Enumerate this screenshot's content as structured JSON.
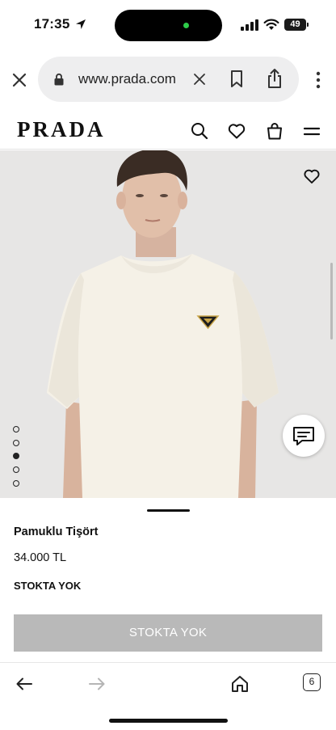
{
  "status_bar": {
    "time": "17:35",
    "battery": "49"
  },
  "browser": {
    "url": "www.prada.com"
  },
  "site": {
    "logo": "PRADA"
  },
  "gallery": {
    "image_count": 5,
    "active_index": 2
  },
  "product": {
    "name": "Pamuklu Tişört",
    "price": "34.000 TL",
    "stock_status": "STOKTA YOK",
    "button_label": "STOKTA YOK"
  },
  "toolbar": {
    "tab_count": "6"
  },
  "colors": {
    "button_disabled": "#b9b9b9",
    "image_background": "#e7e6e5",
    "status_green": "#2ecc4a"
  }
}
